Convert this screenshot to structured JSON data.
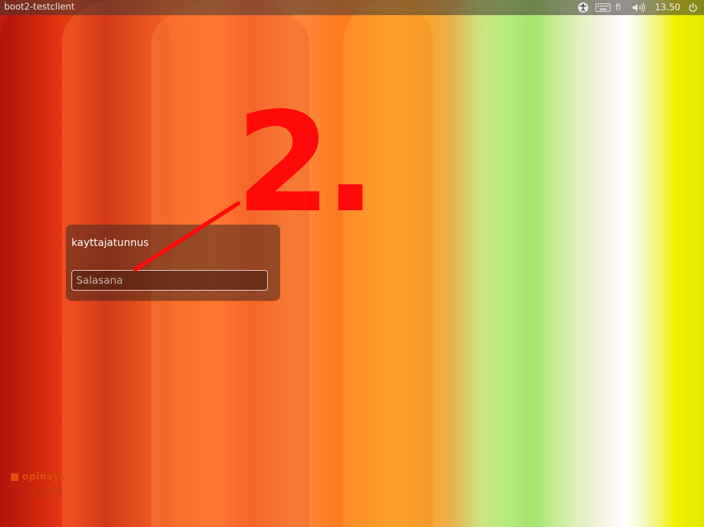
{
  "topbar": {
    "hostname": "boot2-testclient",
    "keyboard_layout": "fi",
    "clock": "13.50",
    "icons": {
      "accessibility": "accessibility-icon",
      "keyboard": "keyboard-icon",
      "volume": "volume-icon",
      "power": "power-icon"
    }
  },
  "login": {
    "username": "kayttajatunnus",
    "password_placeholder": "Salasana",
    "password_value": ""
  },
  "annotation": {
    "label": "2.",
    "color": "#ff0a0a"
  },
  "branding": {
    "name": "opinsys",
    "line1": "NET CLIENT",
    "line2": "14.22 Pos"
  },
  "colors": {
    "brand": "#ea4b0f",
    "topbar_bg": "#3c3732"
  }
}
